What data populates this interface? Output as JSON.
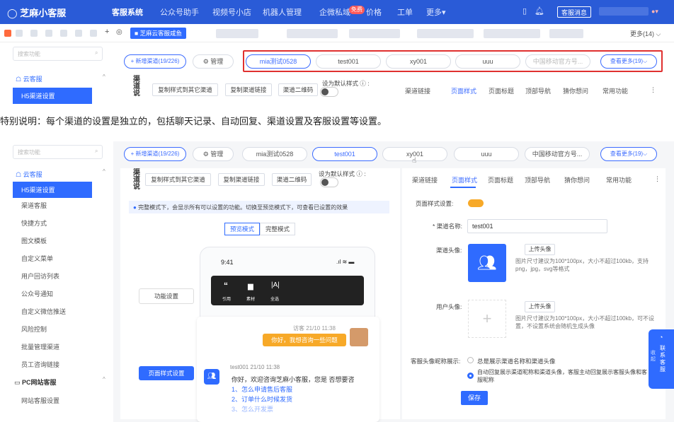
{
  "top1": {
    "brand": "芝麻小客服",
    "nav": [
      "客服系统",
      "公众号助手",
      "视频号小店",
      "机器人管理",
      "企微私域",
      "价格",
      "工单",
      "更多▾"
    ],
    "badge": "免费",
    "right_button": "客服消息"
  },
  "tabs1": {
    "active_tab": "芝麻云客服咸鱼",
    "more": "更多(14) ⌵"
  },
  "left1": {
    "search_placeholder": "搜索功能",
    "group": "云客服",
    "active_item": "H5渠道设置"
  },
  "channels1": {
    "add_btn": "+ 新增渠道(19/226)",
    "manage_btn": "管理",
    "items": [
      "mia测试0528",
      "test001",
      "xy001",
      "uuu",
      "中国移动官方号..."
    ],
    "more_btn": "查看更多(19)⌵"
  },
  "toolbar1": {
    "side_label": "渠道说",
    "copy_style": "复制样式到其它渠道",
    "copy_link": "复制渠道链接",
    "qrcode": "渠道二维码",
    "default_style": "设为默认样式 ⓘ :"
  },
  "righttabs1": [
    "渠道链接",
    "页面样式",
    "页面标题",
    "顶部导航",
    "猜你想问",
    "常用功能",
    "⋮"
  ],
  "notice": "特别说明：每个渠道的设置是独立的，包括聊天记录、自动回复、渠道设置及客服设置等设置。",
  "left2": {
    "search_placeholder": "搜索功能",
    "group": "云客服",
    "items": [
      "H5渠道设置",
      "渠道客服",
      "快捷方式",
      "图文模板",
      "自定义菜单",
      "用户回访列表",
      "公众号通知",
      "自定义微信推送",
      "风险控制",
      "批量管理渠道",
      "员工咨询链接"
    ],
    "group2": "PC网站客服",
    "item2": "网站客服设置"
  },
  "channels2": {
    "add_btn": "+ 新增渠道(19/226)",
    "manage_btn": "管理",
    "items": [
      "mia测试0528",
      "test001",
      "xy001",
      "uuu",
      "中国移动官方号..."
    ],
    "more_btn": "查看更多(19)⌵"
  },
  "toolbar2": {
    "side_label": "渠道说",
    "copy_style": "复制样式到其它渠道",
    "copy_link": "复制渠道链接",
    "qrcode": "渠道二维码",
    "default_style": "设为默认样式 ⓘ :"
  },
  "preview": {
    "info": "完整模式下，会显示所有可以设置的功能。切换至预览模式下，可查看已设置的效果",
    "mode_preview": "预览模式",
    "mode_full": "完整模式",
    "time": "9:41",
    "func_label": "功能设置",
    "toolbar_icons": [
      "引用",
      "素材",
      "全选"
    ],
    "page_style_label": "页面样式设置",
    "visitor_meta": "访客 21/10 11:38",
    "visitor_msg": "你好，我想咨询一些问题",
    "agent_meta": "test001 21/10 11:38",
    "agent_msg": "你好，欢迎咨询芝麻小客服，您是 否想要咨",
    "faq": [
      "1、怎么申请售后客服",
      "2、订单什么时候发货",
      "3、怎么开发票"
    ]
  },
  "righttabs2": [
    "渠道链接",
    "页面样式",
    "页面标题",
    "顶部导航",
    "猜你想问",
    "常用功能",
    "⋮"
  ],
  "form": {
    "page_style_label": "页面样式设置:",
    "channel_name_label": "* 渠道名称:",
    "channel_name_value": "test001",
    "channel_avatar_label": "渠道头像:",
    "upload_btn": "上传头像",
    "avatar_hint": "图片尺寸建议为100*100px，大小不超过100kb，支持png，jpg，svg等格式",
    "user_avatar_label": "用户头像:",
    "upload_btn2": "上传头像",
    "user_avatar_hint": "图片尺寸建议为100*100px，大小不超过100kb，可不设置，不设置系统会随机生成头像",
    "display_label": "客服头像昵称展示:",
    "opt1": "总是展示渠道名称和渠道头像",
    "opt2": "自动回复展示渠道昵称和渠道头像，客服主动回复展示客服头像和客服昵称",
    "save": "保存"
  },
  "float_widget": {
    "text": "联系客服",
    "collapse": "收起"
  }
}
